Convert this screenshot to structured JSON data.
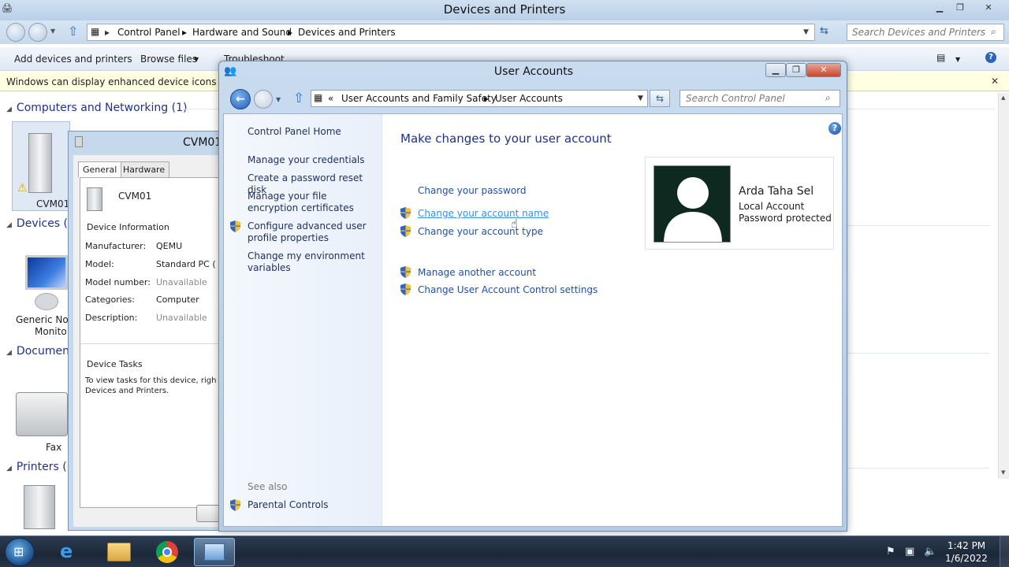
{
  "bg_window": {
    "title": "Devices and Printers",
    "breadcrumb": [
      "Control Panel",
      "Hardware and Sound",
      "Devices and Printers"
    ],
    "search_placeholder": "Search Devices and Printers",
    "toolbar": {
      "add_devices": "Add devices and printers",
      "browse_files": "Browse files",
      "troubleshoot": "Troubleshoot"
    },
    "infobar_text": "Windows can display enhanced device icons and in",
    "groups": [
      {
        "label": "Computers and Networking (1)"
      },
      {
        "label": "Devices (2"
      },
      {
        "label": "Documen"
      },
      {
        "label": "Printers (1"
      }
    ],
    "devices": {
      "computer": "CVM01",
      "monitor_line1": "Generic Non",
      "monitor_line2": "Monito",
      "fax": "Fax"
    }
  },
  "props_window": {
    "title": "CVM01",
    "tabs": [
      "General",
      "Hardware"
    ],
    "device_name": "CVM01",
    "section_info": "Device Information",
    "rows": [
      {
        "label": "Manufacturer:",
        "value": "QEMU"
      },
      {
        "label": "Model:",
        "value": "Standard PC ("
      },
      {
        "label": "Model number:",
        "value": "Unavailable"
      },
      {
        "label": "Categories:",
        "value": "Computer"
      },
      {
        "label": "Description:",
        "value": "Unavailable"
      }
    ],
    "section_tasks": "Device Tasks",
    "tasks_line1": "To view tasks for this device, righ",
    "tasks_line2": "Devices and Printers."
  },
  "ua_window": {
    "title": "User Accounts",
    "breadcrumb_prefix": "«",
    "breadcrumb": [
      "User Accounts and Family Safety",
      "User Accounts"
    ],
    "search_placeholder": "Search Control Panel",
    "left_nav": {
      "home": "Control Panel Home",
      "credentials": "Manage your credentials",
      "reset_disk": "Create a password reset disk",
      "encryption": "Manage your file encryption certificates",
      "advanced_profile": "Configure advanced user profile properties",
      "environment": "Change my environment variables",
      "see_also": "See also",
      "parental": "Parental Controls"
    },
    "main_title": "Make changes to your user account",
    "tasks": {
      "change_password": "Change your password",
      "change_name": "Change your account name",
      "change_type": "Change your account type",
      "manage_another": "Manage another account",
      "uac_settings": "Change User Account Control settings"
    },
    "user": {
      "name": "Arda Taha Sel",
      "account_type": "Local Account",
      "status": "Password protected"
    }
  },
  "taskbar": {
    "time": "1:42 PM",
    "date": "1/6/2022"
  },
  "colors": {
    "link": "#1f50a8",
    "link_hover": "#3c8fe0",
    "heading": "#1e3287",
    "info_bar": "#ffffe1"
  }
}
